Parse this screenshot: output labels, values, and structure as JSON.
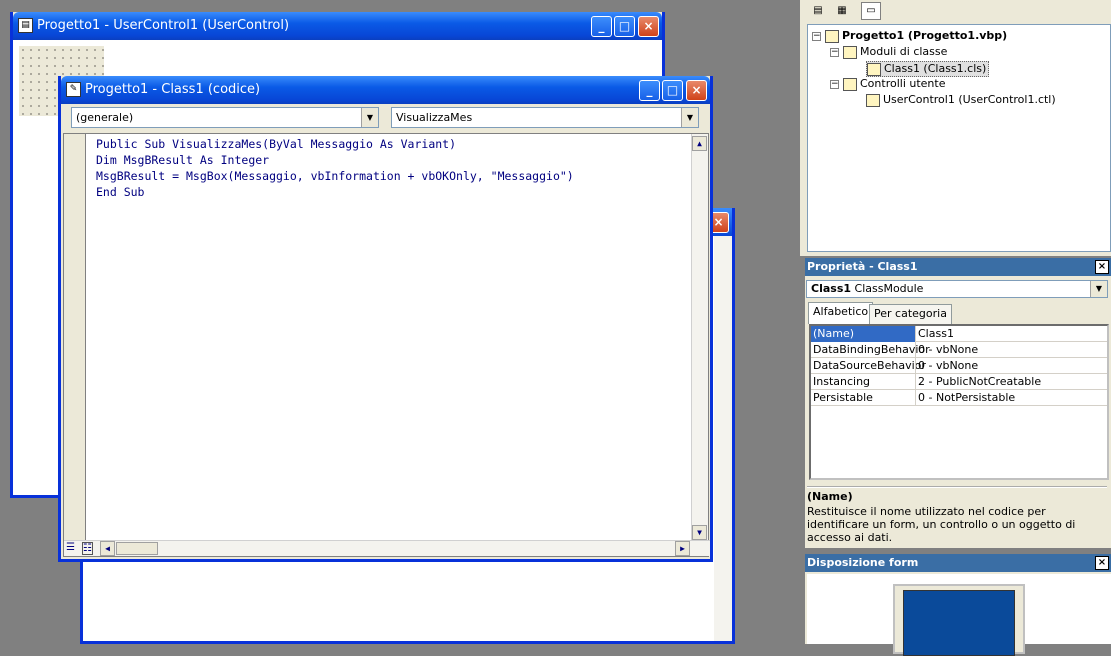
{
  "window_usercontrol": {
    "title": "Progetto1 - UserControl1 (UserControl)"
  },
  "window_code": {
    "title": "Progetto1 - Class1 (codice)",
    "object_combo": "(generale)",
    "proc_combo": "VisualizzaMes",
    "code_lines": [
      "Public Sub VisualizzaMes(ByVal Messaggio As Variant)",
      "Dim MsgBResult As Integer",
      "MsgBResult = MsgBox(Messaggio, vbInformation + vbOKOnly, \"Messaggio\")",
      "End Sub"
    ]
  },
  "project_explorer": {
    "nodes": [
      {
        "label": "Progetto1 (Progetto1.vbp)",
        "level": 0
      },
      {
        "label": "Moduli di classe",
        "level": 1
      },
      {
        "label": "Class1 (Class1.cls)",
        "level": 2
      },
      {
        "label": "Controlli utente",
        "level": 1
      },
      {
        "label": "UserControl1 (UserControl1.ctl)",
        "level": 2
      }
    ]
  },
  "properties": {
    "title": "Proprietà - Class1",
    "object_name": "Class1",
    "object_type": "ClassModule",
    "tabs": [
      "Alfabetico",
      "Per categoria"
    ],
    "rows": [
      {
        "name": "(Name)",
        "value": "Class1"
      },
      {
        "name": "DataBindingBehavior",
        "value": "0 - vbNone"
      },
      {
        "name": "DataSourceBehavior",
        "value": "0 - vbNone"
      },
      {
        "name": "Instancing",
        "value": "2 - PublicNotCreatable"
      },
      {
        "name": "Persistable",
        "value": "0 - NotPersistable"
      }
    ],
    "desc_title": "(Name)",
    "desc_text": "Restituisce il nome utilizzato nel codice per identificare un form, un controllo o un oggetto di accesso ai dati."
  },
  "form_layout": {
    "title": "Disposizione form"
  },
  "colors": {
    "titlebar": "#0a5ae6",
    "panel_title": "#3a6ea5",
    "code_text": "#000080",
    "form_preview": "#0a4a9a"
  },
  "icons": {
    "close": "×",
    "minimize": "_",
    "maximize": "□",
    "combo_arrow": "▼"
  }
}
